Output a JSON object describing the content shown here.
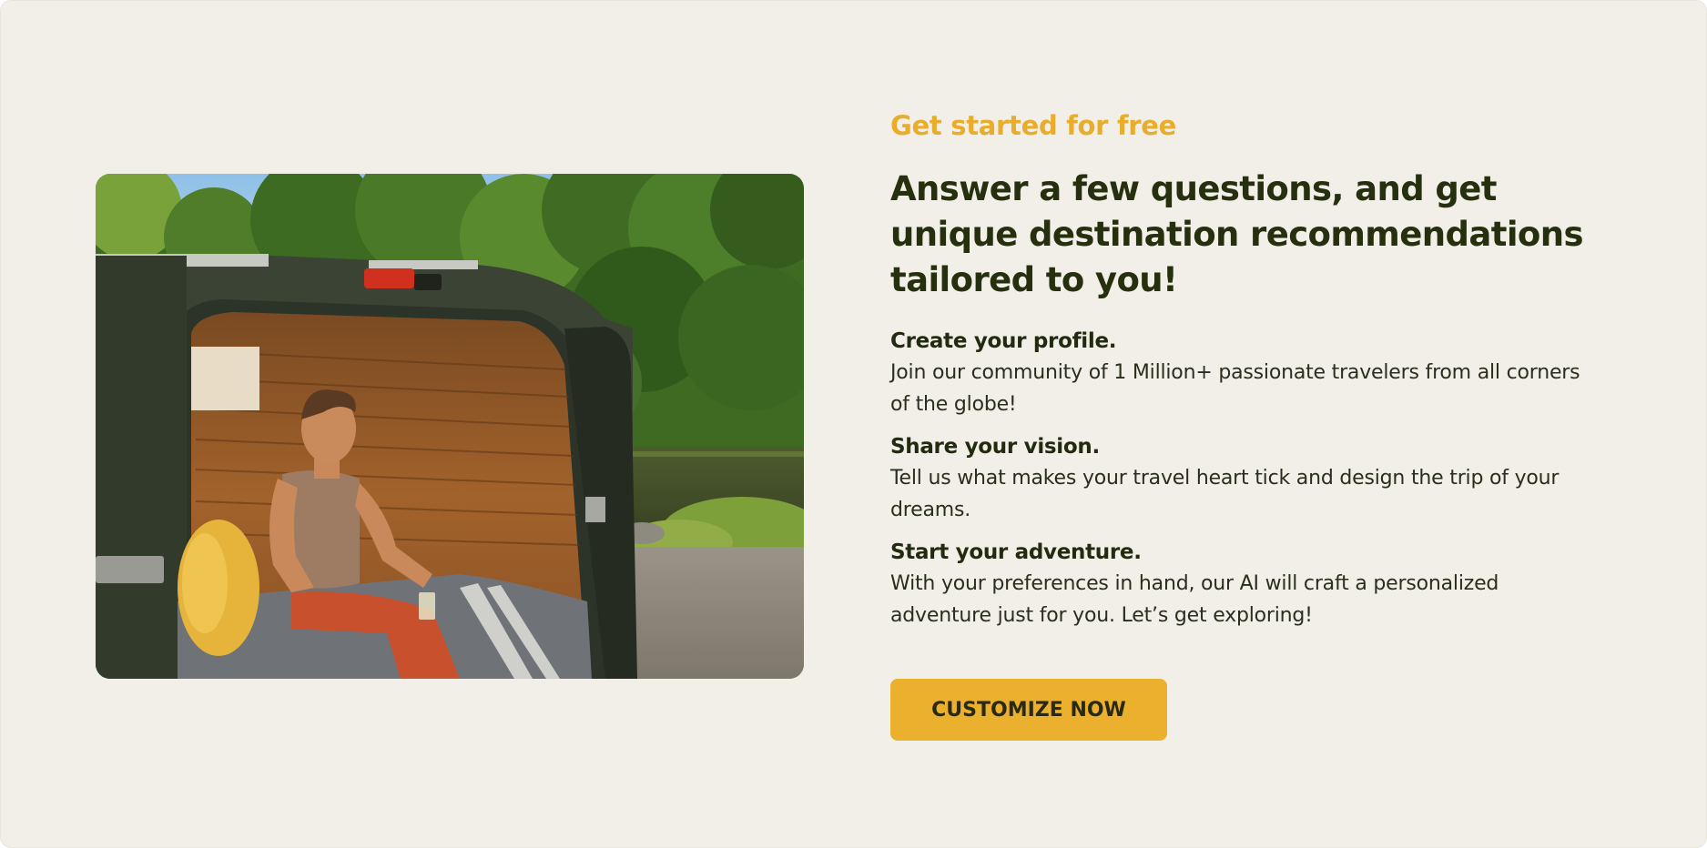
{
  "eyebrow": "Get started for free",
  "headline": "Answer a few questions, and get unique destination recommendations tailored to you!",
  "steps": [
    {
      "title": "Create your profile.",
      "text": "Join our community of 1 Million+ passionate travelers from all corners of the globe!"
    },
    {
      "title": "Share your vision.",
      "text": "Tell us what makes your travel heart tick and design the trip of your dreams."
    },
    {
      "title": "Start your adventure.",
      "text": "With your preferences in hand, our AI will craft a personalized adventure just for you. Let’s get exploring!"
    }
  ],
  "cta": {
    "label": "CUSTOMIZE NOW"
  },
  "photo": {
    "alt": "Woman sitting in the back of a camper van by a lake surrounded by trees"
  },
  "colors": {
    "background": "#f1efe7",
    "accent": "#ebb02e",
    "eyebrow": "#e8ad2b",
    "heading": "#27300e",
    "body_text": "#2a2e1c"
  }
}
